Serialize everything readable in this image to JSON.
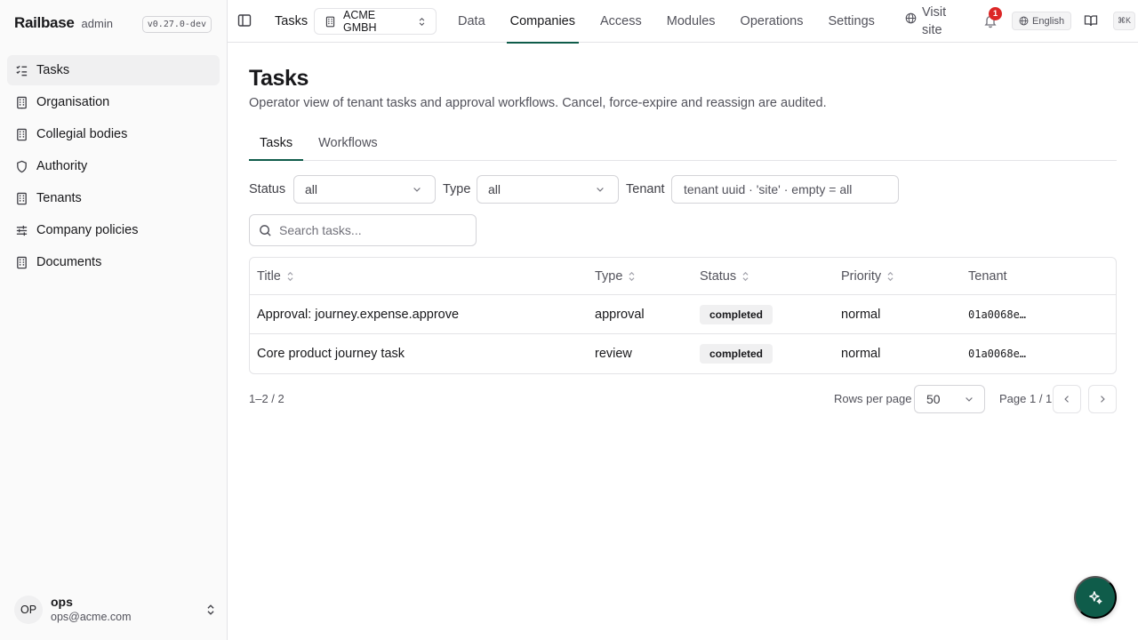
{
  "sidebar": {
    "brand": "Railbase",
    "role": "admin",
    "version": "v0.27.0-dev",
    "items": [
      {
        "label": "Tasks",
        "icon": "tasks-icon",
        "active": true
      },
      {
        "label": "Organisation",
        "icon": "building-icon"
      },
      {
        "label": "Collegial bodies",
        "icon": "building-icon"
      },
      {
        "label": "Authority",
        "icon": "shield-icon"
      },
      {
        "label": "Tenants",
        "icon": "building-icon"
      },
      {
        "label": "Company policies",
        "icon": "sliders-icon"
      },
      {
        "label": "Documents",
        "icon": "building-icon"
      }
    ],
    "user": {
      "initials": "OP",
      "name": "ops",
      "email": "ops@acme.com"
    }
  },
  "topbar": {
    "title": "Tasks",
    "company": "ACME GMBH",
    "nav": [
      {
        "label": "Data"
      },
      {
        "label": "Companies",
        "active": true
      },
      {
        "label": "Access"
      },
      {
        "label": "Modules"
      },
      {
        "label": "Operations"
      },
      {
        "label": "Settings"
      }
    ],
    "visit_line1": "Visit",
    "visit_line2": "site",
    "notifications": "1",
    "language": "English",
    "shortcut": "⌘K"
  },
  "page": {
    "title": "Tasks",
    "description": "Operator view of tenant tasks and approval workflows. Cancel, force-expire and reassign are audited.",
    "tabs": [
      {
        "label": "Tasks",
        "active": true
      },
      {
        "label": "Workflows"
      }
    ]
  },
  "filters": {
    "status_label": "Status",
    "status_value": "all",
    "type_label": "Type",
    "type_value": "all",
    "tenant_label": "Tenant",
    "tenant_placeholder": "tenant uuid · 'site' · empty = all",
    "search_placeholder": "Search tasks..."
  },
  "table": {
    "columns": [
      "Title",
      "Type",
      "Status",
      "Priority",
      "Tenant"
    ],
    "rows": [
      {
        "title": "Approval: journey.expense.approve",
        "type": "approval",
        "status": "completed",
        "priority": "normal",
        "tenant": "01a0068e…"
      },
      {
        "title": "Core product journey task",
        "type": "review",
        "status": "completed",
        "priority": "normal",
        "tenant": "01a0068e…"
      }
    ]
  },
  "pagination": {
    "count": "1–2 / 2",
    "rows_per_page_label": "Rows per page",
    "rows_per_page": "50",
    "page_info": "Page 1 / 1"
  },
  "colors": {
    "accent": "#0f5c4a",
    "badge": "#dc2626"
  }
}
